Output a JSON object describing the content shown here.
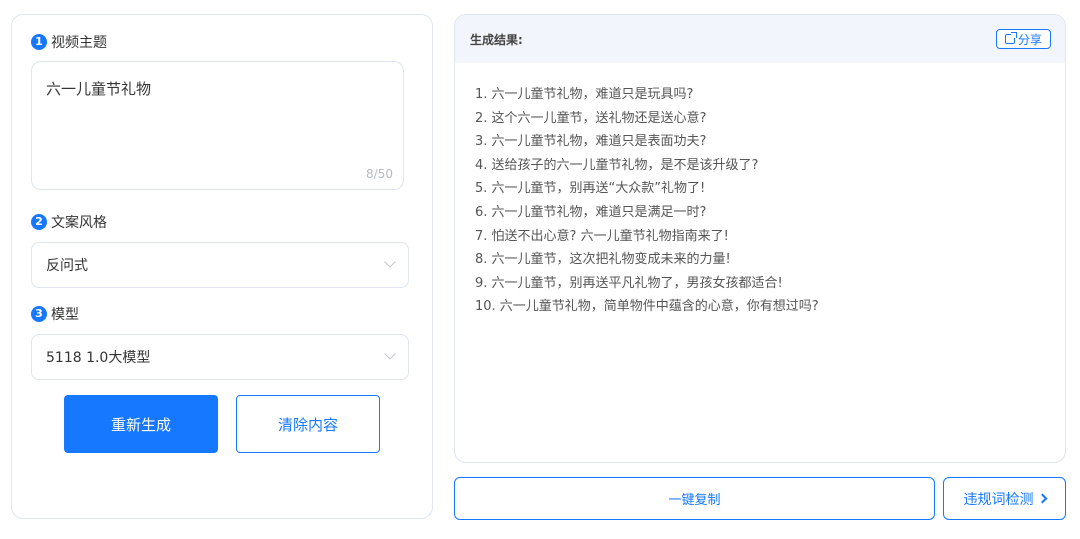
{
  "form": {
    "topic_section": {
      "number": "1",
      "label": "视频主题"
    },
    "topic_value": "六一儿童节礼物",
    "topic_count": "8/50",
    "style_section": {
      "number": "2",
      "label": "文案风格"
    },
    "style_value": "反问式",
    "model_section": {
      "number": "3",
      "label": "模型"
    },
    "model_value": "5118 1.0大模型",
    "regenerate_label": "重新生成",
    "clear_label": "清除内容"
  },
  "result": {
    "title": "生成结果:",
    "share_label": "分享",
    "items": [
      "1. 六一儿童节礼物，难道只是玩具吗?",
      "2. 这个六一儿童节，送礼物还是送心意?",
      "3. 六一儿童节礼物，难道只是表面功夫?",
      "4. 送给孩子的六一儿童节礼物，是不是该升级了?",
      "5. 六一儿童节，别再送“大众款”礼物了!",
      "6. 六一儿童节礼物，难道只是满足一时?",
      "7. 怕送不出心意? 六一儿童节礼物指南来了!",
      "8. 六一儿童节，这次把礼物变成未来的力量!",
      "9. 六一儿童节，别再送平凡礼物了，男孩女孩都适合!",
      "10. 六一儿童节礼物，简单物件中蕴含的心意，你有想过吗?"
    ]
  },
  "actions": {
    "copy_label": "一键复制",
    "check_label": "违规词检测"
  }
}
